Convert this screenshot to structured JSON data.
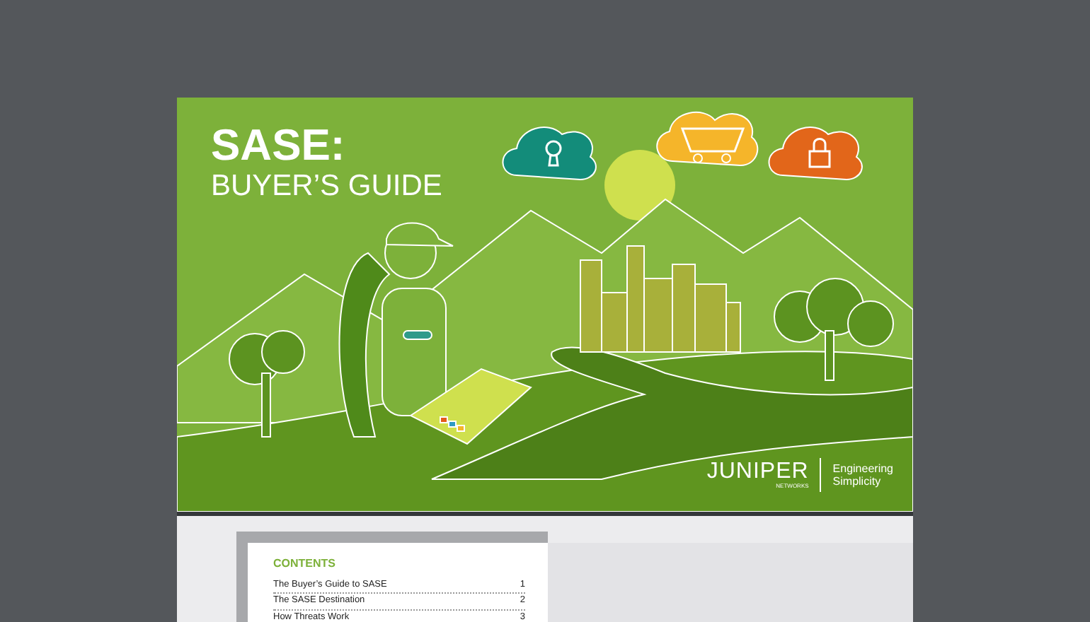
{
  "cover": {
    "title": "SASE:",
    "subtitle": "BUYER’S GUIDE",
    "logo": {
      "wordmark": "JUNIPER",
      "sub": "NETWORKS"
    },
    "tagline": [
      "Engineering",
      "Simplicity"
    ]
  },
  "contents": {
    "heading": "CONTENTS",
    "entries": [
      {
        "title": "The Buyer’s Guide to SASE",
        "page": "1"
      },
      {
        "title": "The SASE Destination",
        "page": "2"
      },
      {
        "title": "How Threats Work",
        "page": "3"
      }
    ]
  }
}
